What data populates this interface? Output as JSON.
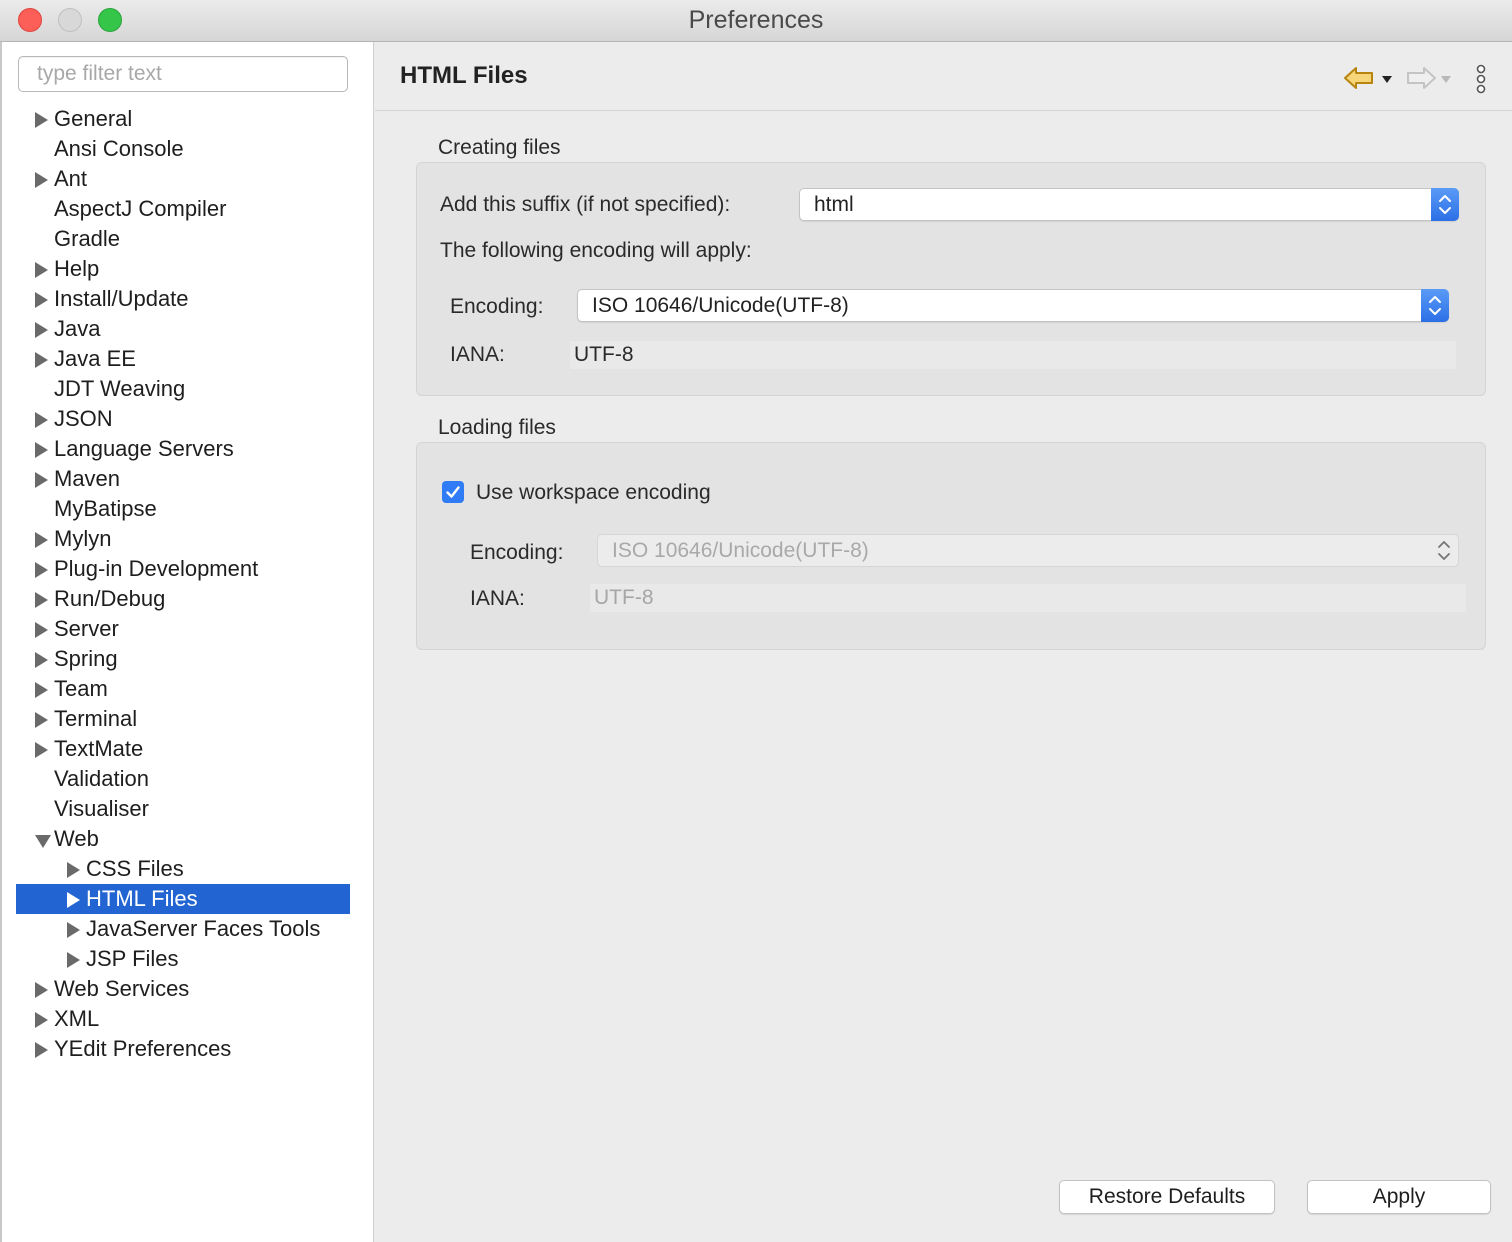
{
  "window": {
    "title": "Preferences"
  },
  "sidebar": {
    "filter_placeholder": "type filter text",
    "items": [
      {
        "label": "General",
        "arrow": "right",
        "indent": 0
      },
      {
        "label": "Ansi Console",
        "arrow": "none",
        "indent": 0
      },
      {
        "label": "Ant",
        "arrow": "right",
        "indent": 0
      },
      {
        "label": "AspectJ Compiler",
        "arrow": "none",
        "indent": 0
      },
      {
        "label": "Gradle",
        "arrow": "none",
        "indent": 0
      },
      {
        "label": "Help",
        "arrow": "right",
        "indent": 0
      },
      {
        "label": "Install/Update",
        "arrow": "right",
        "indent": 0
      },
      {
        "label": "Java",
        "arrow": "right",
        "indent": 0
      },
      {
        "label": "Java EE",
        "arrow": "right",
        "indent": 0
      },
      {
        "label": "JDT Weaving",
        "arrow": "none",
        "indent": 0
      },
      {
        "label": "JSON",
        "arrow": "right",
        "indent": 0
      },
      {
        "label": "Language Servers",
        "arrow": "right",
        "indent": 0
      },
      {
        "label": "Maven",
        "arrow": "right",
        "indent": 0
      },
      {
        "label": "MyBatipse",
        "arrow": "none",
        "indent": 0
      },
      {
        "label": "Mylyn",
        "arrow": "right",
        "indent": 0
      },
      {
        "label": "Plug-in Development",
        "arrow": "right",
        "indent": 0
      },
      {
        "label": "Run/Debug",
        "arrow": "right",
        "indent": 0
      },
      {
        "label": "Server",
        "arrow": "right",
        "indent": 0
      },
      {
        "label": "Spring",
        "arrow": "right",
        "indent": 0
      },
      {
        "label": "Team",
        "arrow": "right",
        "indent": 0
      },
      {
        "label": "Terminal",
        "arrow": "right",
        "indent": 0
      },
      {
        "label": "TextMate",
        "arrow": "right",
        "indent": 0
      },
      {
        "label": "Validation",
        "arrow": "none",
        "indent": 0
      },
      {
        "label": "Visualiser",
        "arrow": "none",
        "indent": 0
      },
      {
        "label": "Web",
        "arrow": "down",
        "indent": 0
      },
      {
        "label": "CSS Files",
        "arrow": "right",
        "indent": 1
      },
      {
        "label": "HTML Files",
        "arrow": "right",
        "indent": 1,
        "selected": true
      },
      {
        "label": "JavaServer Faces Tools",
        "arrow": "right",
        "indent": 1
      },
      {
        "label": "JSP Files",
        "arrow": "right",
        "indent": 1
      },
      {
        "label": "Web Services",
        "arrow": "right",
        "indent": 0
      },
      {
        "label": "XML",
        "arrow": "right",
        "indent": 0
      },
      {
        "label": "YEdit Preferences",
        "arrow": "right",
        "indent": 0
      }
    ]
  },
  "header": {
    "title": "HTML Files",
    "icons": [
      "back-arrow-icon",
      "forward-arrow-icon",
      "view-menu-icon"
    ]
  },
  "creating": {
    "section_label": "Creating files",
    "suffix_label": "Add this suffix (if not specified):",
    "suffix_value": "html",
    "encoding_note": "The following encoding will apply:",
    "encoding_label": "Encoding:",
    "encoding_value": "ISO 10646/Unicode(UTF-8)",
    "iana_label": "IANA:",
    "iana_value": "UTF-8"
  },
  "loading": {
    "section_label": "Loading files",
    "checkbox_label": "Use workspace encoding",
    "checkbox_checked": true,
    "encoding_label": "Encoding:",
    "encoding_value": "ISO 10646/Unicode(UTF-8)",
    "iana_label": "IANA:",
    "iana_value": "UTF-8"
  },
  "buttons": {
    "restore_defaults": "Restore Defaults",
    "apply": "Apply"
  },
  "colors": {
    "selection": "#2264d1",
    "checkbox": "#2f7cf6",
    "back_arrow": "#e0a020"
  }
}
